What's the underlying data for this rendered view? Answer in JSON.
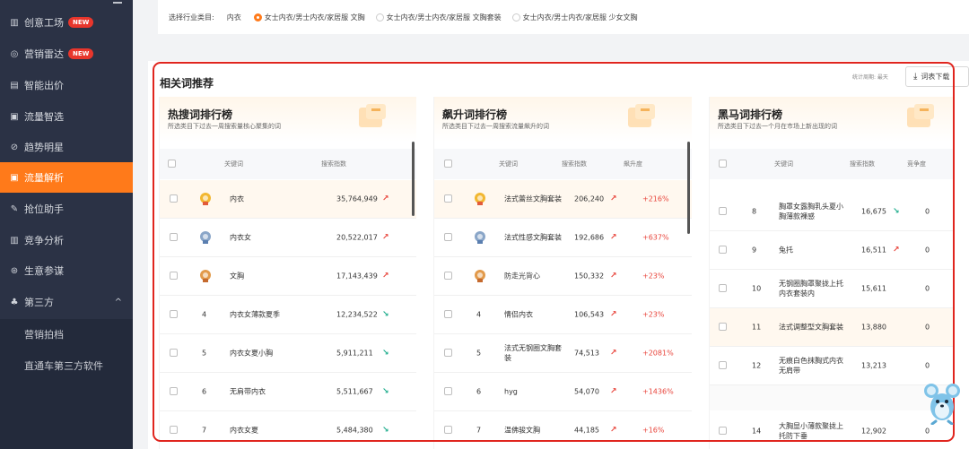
{
  "sidebar": {
    "items": [
      {
        "label": "创意工场",
        "icon": "creative-icon",
        "badge": "NEW"
      },
      {
        "label": "营销雷达",
        "icon": "radar-icon",
        "badge": "NEW"
      },
      {
        "label": "智能出价",
        "icon": "bid-icon"
      },
      {
        "label": "流量智选",
        "icon": "traffic-select-icon"
      },
      {
        "label": "趋势明星",
        "icon": "trend-star-icon"
      },
      {
        "label": "流量解析",
        "icon": "traffic-analysis-icon"
      },
      {
        "label": "抢位助手",
        "icon": "rank-helper-icon"
      },
      {
        "label": "竞争分析",
        "icon": "competition-icon"
      },
      {
        "label": "生意参谋",
        "icon": "business-advisor-icon"
      },
      {
        "label": "第三方",
        "icon": "third-party-icon",
        "chevron": "^"
      }
    ],
    "sub_items": [
      "营销拍档",
      "直通车第三方软件"
    ]
  },
  "filter": {
    "label": "选择行业类目:",
    "category": "内衣",
    "options": [
      "女士内衣/男士内衣/家居服 文胸",
      "女士内衣/男士内衣/家居服 文胸套装",
      "女士内衣/男士内衣/家居服 少女文胸"
    ]
  },
  "panel": {
    "title": "相关词推荐",
    "period": "统计周期: 最天",
    "download": "词表下载"
  },
  "hot": {
    "title": "热搜词排行榜",
    "subtitle": "所选类目下过去一周搜索量核心聚集的词",
    "col_keyword": "关键词",
    "col_index": "搜索指数",
    "rows": [
      {
        "rank": "1",
        "keyword": "内衣",
        "index": "35,764,949",
        "trend": "up"
      },
      {
        "rank": "2",
        "keyword": "内衣女",
        "index": "20,522,017",
        "trend": "up"
      },
      {
        "rank": "3",
        "keyword": "文胸",
        "index": "17,143,439",
        "trend": "up"
      },
      {
        "rank": "4",
        "keyword": "内衣女薄款夏季",
        "index": "12,234,522",
        "trend": "down"
      },
      {
        "rank": "5",
        "keyword": "内衣女夏小胸",
        "index": "5,911,211",
        "trend": "down"
      },
      {
        "rank": "6",
        "keyword": "无肩带内衣",
        "index": "5,511,667",
        "trend": "down"
      },
      {
        "rank": "7",
        "keyword": "内衣女夏",
        "index": "5,484,380",
        "trend": "down"
      }
    ]
  },
  "rising": {
    "title": "飙升词排行榜",
    "subtitle": "所选类目下过去一周搜索流量飙升的词",
    "col_keyword": "关键词",
    "col_index": "搜索指数",
    "col_rate": "飙升度",
    "rows": [
      {
        "rank": "1",
        "keyword": "法式蕾丝文胸套装",
        "index": "206,240",
        "trend": "up",
        "rate": "+216%"
      },
      {
        "rank": "2",
        "keyword": "法式性感文胸套装",
        "index": "192,686",
        "trend": "up",
        "rate": "+637%"
      },
      {
        "rank": "3",
        "keyword": "防走光背心",
        "index": "150,332",
        "trend": "up",
        "rate": "+23%"
      },
      {
        "rank": "4",
        "keyword": "情侣内衣",
        "index": "106,543",
        "trend": "up",
        "rate": "+23%"
      },
      {
        "rank": "5",
        "keyword": "法式无钢圈文胸套装",
        "index": "74,513",
        "trend": "up",
        "rate": "+2081%"
      },
      {
        "rank": "6",
        "keyword": "hyg",
        "index": "54,070",
        "trend": "up",
        "rate": "+1436%"
      },
      {
        "rank": "7",
        "keyword": "温佛骏文胸",
        "index": "44,185",
        "trend": "up",
        "rate": "+16%"
      }
    ]
  },
  "darkhorse": {
    "title": "黑马词排行榜",
    "subtitle": "所选类目下过去一个月在市场上新出现的词",
    "col_keyword": "关键词",
    "col_index": "搜索指数",
    "col_comp": "竞争度",
    "rows": [
      {
        "rank": "8",
        "keyword": "胸罩女露胸乳头夏小胸薄款裸感",
        "index": "16,675",
        "trend": "down",
        "comp": "0"
      },
      {
        "rank": "9",
        "keyword": "兔托",
        "index": "16,511",
        "trend": "up",
        "comp": "0"
      },
      {
        "rank": "10",
        "keyword": "无钢圈胸罩聚拢上托内衣套装内",
        "index": "15,611",
        "trend": "",
        "comp": "0"
      },
      {
        "rank": "11",
        "keyword": "法式调整型文胸套装",
        "index": "13,880",
        "trend": "",
        "comp": "0"
      },
      {
        "rank": "12",
        "keyword": "无痕白色抹胸式内衣无肩带",
        "index": "13,213",
        "trend": "",
        "comp": "0"
      },
      {
        "rank": "14",
        "keyword": "大胸显小薄款聚拢上托防下垂",
        "index": "12,902",
        "trend": "",
        "comp": "0"
      }
    ]
  },
  "colors": {
    "accent": "#ff7a1a",
    "sidebar_bg": "#2b3245",
    "highlight_box": "#e0251e",
    "up": "#e8453c",
    "down": "#1aab8a"
  }
}
